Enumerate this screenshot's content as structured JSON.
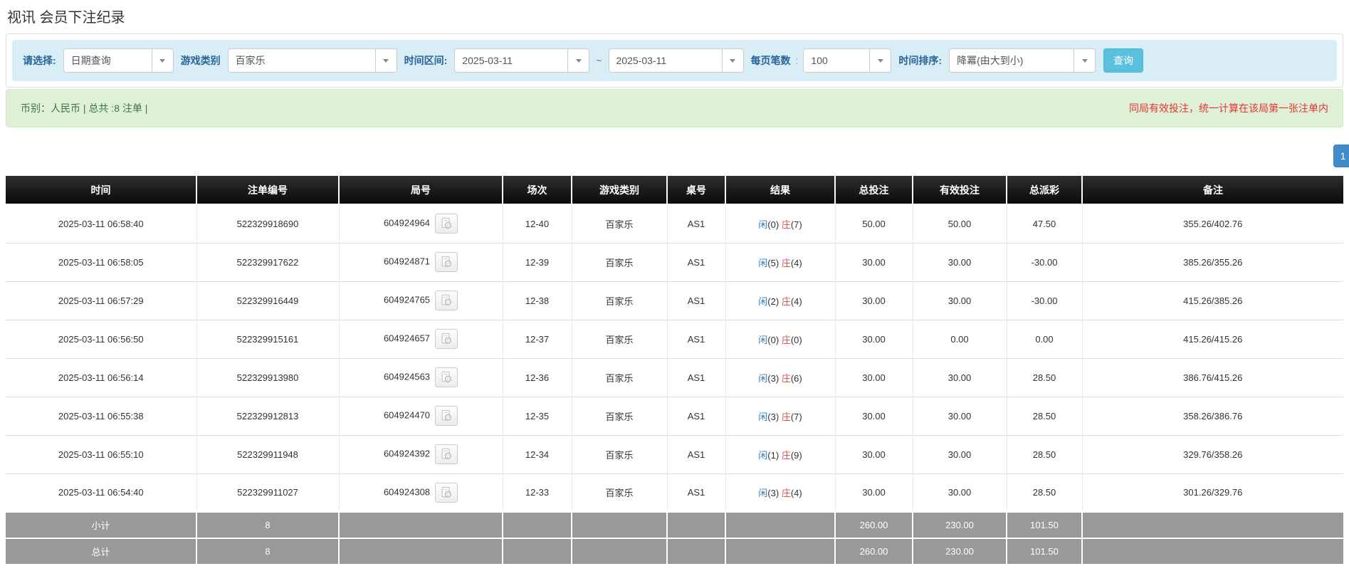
{
  "page": {
    "title": "视讯 会员下注纪录"
  },
  "filters": {
    "select_type": {
      "label": "请选择:",
      "value": "日期查询"
    },
    "game_category": {
      "label": "游戏类别",
      "value": "百家乐"
    },
    "time_range": {
      "label": "时间区间:",
      "from": "2025-03-11",
      "separator": "~",
      "to": "2025-03-11"
    },
    "page_size": {
      "label": "每页笔数",
      "colon": ":",
      "value": "100"
    },
    "time_sort": {
      "label": "时间排序:",
      "value": "降冪(由大到小)"
    },
    "search_button": "查询"
  },
  "summary": {
    "left_text": "币别：人民币 | 总共 :8 注单 |",
    "right_note": "同局有效投注，统一计算在该局第一张注单内"
  },
  "pagination": {
    "current": "1"
  },
  "colors": {
    "accent_blue": "#428bca",
    "info_button": "#5bc0de",
    "player_blue": "#337ab7",
    "banker_red": "#d9534f",
    "negative_red": "#dd0000",
    "alert_bg": "#dff0d8",
    "alert_text": "#3c763d",
    "note_red": "#e53430",
    "header_black": "#111111",
    "footer_grey": "#999999"
  },
  "table": {
    "headers": [
      "时间",
      "注单编号",
      "局号",
      "场次",
      "游戏类别",
      "桌号",
      "结果",
      "总投注",
      "有效投注",
      "总派彩",
      "备注"
    ],
    "rows": [
      {
        "time": "2025-03-11 06:58:40",
        "bet_id": "522329918690",
        "round_id": "604924964",
        "session": "12-40",
        "game": "百家乐",
        "table_no": "AS1",
        "result_player_label": "闲",
        "result_player_num": "(0)",
        "result_banker_label": "庄",
        "result_banker_num": "(7)",
        "total_bet": "50.00",
        "valid_bet": "50.00",
        "payout": "47.50",
        "remark": "355.26/402.76"
      },
      {
        "time": "2025-03-11 06:58:05",
        "bet_id": "522329917622",
        "round_id": "604924871",
        "session": "12-39",
        "game": "百家乐",
        "table_no": "AS1",
        "result_player_label": "闲",
        "result_player_num": "(5)",
        "result_banker_label": "庄",
        "result_banker_num": "(4)",
        "total_bet": "30.00",
        "valid_bet": "30.00",
        "payout": "-30.00",
        "remark": "385.26/355.26"
      },
      {
        "time": "2025-03-11 06:57:29",
        "bet_id": "522329916449",
        "round_id": "604924765",
        "session": "12-38",
        "game": "百家乐",
        "table_no": "AS1",
        "result_player_label": "闲",
        "result_player_num": "(2)",
        "result_banker_label": "庄",
        "result_banker_num": "(4)",
        "total_bet": "30.00",
        "valid_bet": "30.00",
        "payout": "-30.00",
        "remark": "415.26/385.26"
      },
      {
        "time": "2025-03-11 06:56:50",
        "bet_id": "522329915161",
        "round_id": "604924657",
        "session": "12-37",
        "game": "百家乐",
        "table_no": "AS1",
        "result_player_label": "闲",
        "result_player_num": "(0)",
        "result_banker_label": "庄",
        "result_banker_num": "(0)",
        "total_bet": "30.00",
        "valid_bet": "0.00",
        "payout": "0.00",
        "remark": "415.26/415.26"
      },
      {
        "time": "2025-03-11 06:56:14",
        "bet_id": "522329913980",
        "round_id": "604924563",
        "session": "12-36",
        "game": "百家乐",
        "table_no": "AS1",
        "result_player_label": "闲",
        "result_player_num": "(3)",
        "result_banker_label": "庄",
        "result_banker_num": "(6)",
        "total_bet": "30.00",
        "valid_bet": "30.00",
        "payout": "28.50",
        "remark": "386.76/415.26"
      },
      {
        "time": "2025-03-11 06:55:38",
        "bet_id": "522329912813",
        "round_id": "604924470",
        "session": "12-35",
        "game": "百家乐",
        "table_no": "AS1",
        "result_player_label": "闲",
        "result_player_num": "(3)",
        "result_banker_label": "庄",
        "result_banker_num": "(7)",
        "total_bet": "30.00",
        "valid_bet": "30.00",
        "payout": "28.50",
        "remark": "358.26/386.76"
      },
      {
        "time": "2025-03-11 06:55:10",
        "bet_id": "522329911948",
        "round_id": "604924392",
        "session": "12-34",
        "game": "百家乐",
        "table_no": "AS1",
        "result_player_label": "闲",
        "result_player_num": "(1)",
        "result_banker_label": "庄",
        "result_banker_num": "(9)",
        "total_bet": "30.00",
        "valid_bet": "30.00",
        "payout": "28.50",
        "remark": "329.76/358.26"
      },
      {
        "time": "2025-03-11 06:54:40",
        "bet_id": "522329911027",
        "round_id": "604924308",
        "session": "12-33",
        "game": "百家乐",
        "table_no": "AS1",
        "result_player_label": "闲",
        "result_player_num": "(3)",
        "result_banker_label": "庄",
        "result_banker_num": "(4)",
        "total_bet": "30.00",
        "valid_bet": "30.00",
        "payout": "28.50",
        "remark": "301.26/329.76"
      }
    ],
    "subtotal": {
      "label": "小计",
      "count": "8",
      "total_bet": "260.00",
      "valid_bet": "230.00",
      "payout": "101.50"
    },
    "total": {
      "label": "总计",
      "count": "8",
      "total_bet": "260.00",
      "valid_bet": "230.00",
      "payout": "101.50"
    }
  }
}
